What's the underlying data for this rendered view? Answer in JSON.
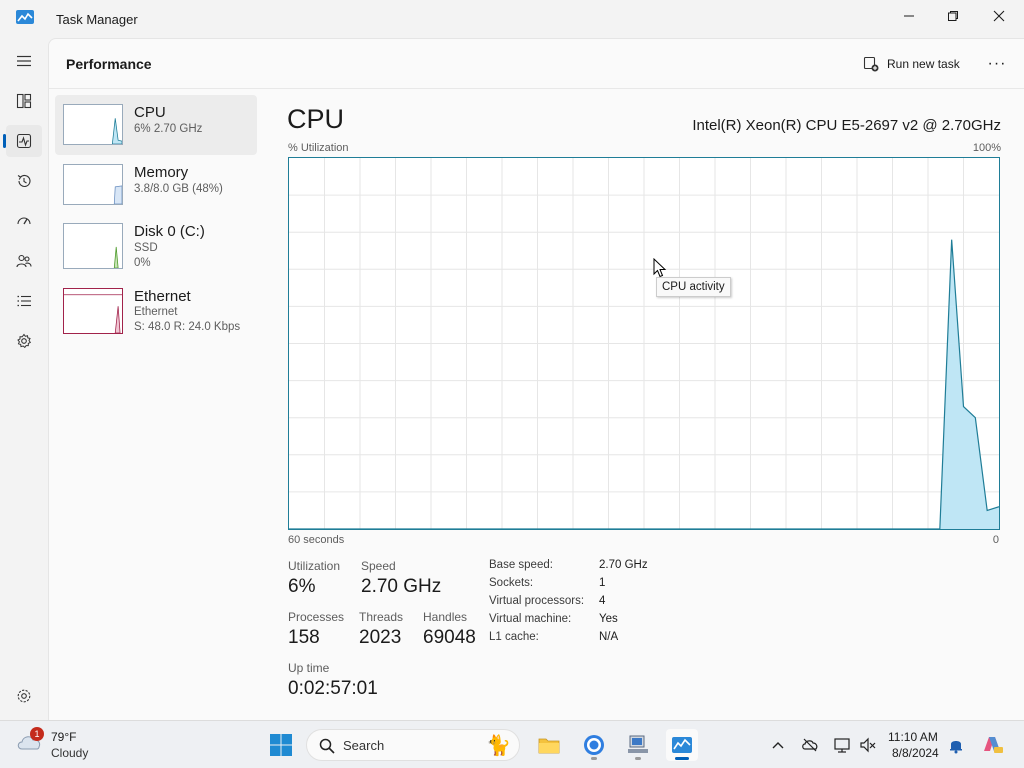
{
  "window": {
    "title": "Task Manager"
  },
  "nav": {
    "items": [
      {
        "name": "nav-processes",
        "icon": "processes-icon"
      },
      {
        "name": "nav-performance",
        "icon": "performance-icon",
        "active": true
      },
      {
        "name": "nav-app-history",
        "icon": "app-history-icon"
      },
      {
        "name": "nav-startup-apps",
        "icon": "startup-apps-icon"
      },
      {
        "name": "nav-users",
        "icon": "users-icon"
      },
      {
        "name": "nav-details",
        "icon": "details-icon"
      },
      {
        "name": "nav-services",
        "icon": "services-icon"
      }
    ],
    "settings_icon": "settings-icon"
  },
  "header": {
    "title": "Performance",
    "run_new_task": "Run new task",
    "more": "···"
  },
  "resources": [
    {
      "name": "CPU",
      "sub1": "6% 2.70 GHz",
      "sub2": "",
      "color": "#1f7d97"
    },
    {
      "name": "Memory",
      "sub1": "3.8/8.0 GB (48%)",
      "sub2": "",
      "color": "#6a8fc0"
    },
    {
      "name": "Disk 0 (C:)",
      "sub1": "SSD",
      "sub2": "0%",
      "color": "#4c9a2a"
    },
    {
      "name": "Ethernet",
      "sub1": "Ethernet",
      "sub2": "S: 48.0  R: 24.0 Kbps",
      "color": "#a1224a"
    }
  ],
  "cpu": {
    "title": "CPU",
    "model": "Intel(R) Xeon(R) CPU E5-2697 v2 @ 2.70GHz",
    "util_label": "% Utilization",
    "max_label": "100%",
    "secs_label": "60 seconds",
    "zero_label": "0",
    "tooltip": "CPU activity",
    "stats": {
      "utilization_label": "Utilization",
      "utilization": "6%",
      "speed_label": "Speed",
      "speed": "2.70 GHz",
      "processes_label": "Processes",
      "processes": "158",
      "threads_label": "Threads",
      "threads": "2023",
      "handles_label": "Handles",
      "handles": "69048",
      "uptime_label": "Up time",
      "uptime": "0:02:57:01"
    },
    "specs": [
      {
        "key": "Base speed:",
        "value": "2.70 GHz"
      },
      {
        "key": "Sockets:",
        "value": "1"
      },
      {
        "key": "Virtual processors:",
        "value": "4"
      },
      {
        "key": "Virtual machine:",
        "value": "Yes"
      },
      {
        "key": "L1 cache:",
        "value": "N/A"
      }
    ],
    "graph_color": "#1f7d97",
    "graph_fill": "#bfe6f5",
    "graph_values": [
      0,
      0,
      0,
      0,
      0,
      0,
      0,
      0,
      0,
      0,
      0,
      0,
      0,
      0,
      0,
      0,
      0,
      0,
      0,
      0,
      0,
      0,
      0,
      0,
      0,
      0,
      0,
      0,
      0,
      0,
      0,
      0,
      0,
      0,
      0,
      0,
      0,
      0,
      0,
      0,
      0,
      0,
      0,
      0,
      0,
      0,
      0,
      0,
      0,
      0,
      0,
      0,
      0,
      0,
      0,
      0,
      78,
      33,
      30,
      5,
      6
    ]
  },
  "taskbar": {
    "weather_temp": "79°F",
    "weather_cond": "Cloudy",
    "weather_badge": "1",
    "search_placeholder": "Search",
    "time": "11:10 AM",
    "date": "8/8/2024"
  }
}
